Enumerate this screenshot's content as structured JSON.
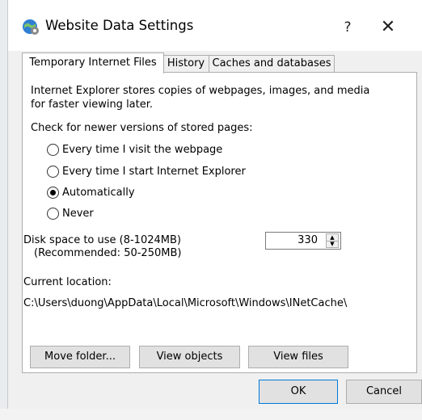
{
  "window": {
    "title": "Website Data Settings",
    "help_glyph": "?",
    "close_glyph": "✕",
    "icon": "ie-settings-icon"
  },
  "tabs": [
    {
      "label": "Temporary Internet Files",
      "active": true
    },
    {
      "label": "History",
      "active": false
    },
    {
      "label": "Caches and databases",
      "active": false
    }
  ],
  "panel": {
    "description_line1": "Internet Explorer stores copies of webpages, images, and media",
    "description_line2": "for faster viewing later.",
    "check_heading": "Check for newer versions of stored pages:",
    "radios": [
      {
        "label": "Every time I visit the webpage",
        "checked": false
      },
      {
        "label": "Every time I start Internet Explorer",
        "checked": false
      },
      {
        "label": "Automatically",
        "checked": true
      },
      {
        "label": "Never",
        "checked": false
      }
    ],
    "disk_space_label": "Disk space to use (8-1024MB)",
    "recommended_label": "(Recommended: 50-250MB)",
    "disk_space_value": "330",
    "current_location_label": "Current location:",
    "current_location_path": "C:\\Users\\duong\\AppData\\Local\\Microsoft\\Windows\\INetCache\\",
    "buttons": {
      "move_folder": "Move folder...",
      "view_objects": "View objects",
      "view_files": "View files"
    }
  },
  "footer": {
    "ok": "OK",
    "cancel": "Cancel"
  },
  "colors": {
    "dialog_bg": "#f0f0f0",
    "panel_bg": "#ffffff",
    "default_button_border": "#0078d7"
  }
}
